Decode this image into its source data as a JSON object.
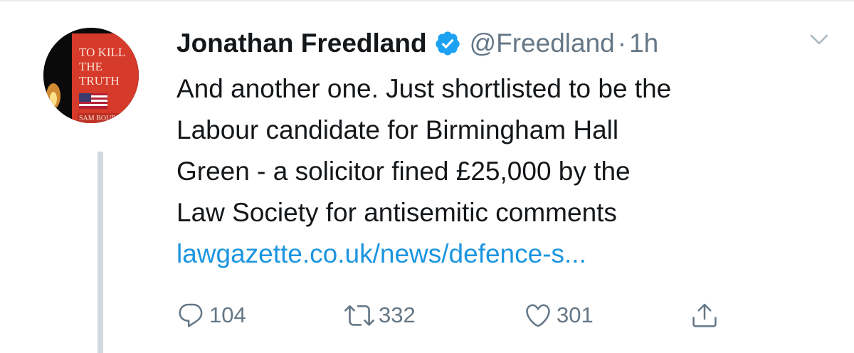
{
  "author": {
    "display_name": "Jonathan Freedland",
    "handle": "@Freedland",
    "separator": "·",
    "time": "1h",
    "avatar_book": {
      "title_line1": "TO KILL",
      "title_line2": "THE",
      "title_line3": "TRUTH",
      "author": "SAM BOURNE"
    }
  },
  "tweet": {
    "lines": [
      "And another one. Just shortlisted to be the",
      "Labour candidate for Birmingham Hall",
      "Green - a solicitor fined £25,000 by the",
      "Law Society for antisemitic comments"
    ],
    "link_text": "lawgazette.co.uk/news/defence-s..."
  },
  "actions": {
    "replies": "104",
    "retweets": "332",
    "likes": "301"
  },
  "colors": {
    "text": "#14171a",
    "secondary": "#657786",
    "link": "#1b95e0",
    "verified": "#1da1f2",
    "book_red": "#d63a2a"
  },
  "icons": {
    "verified": "verified-badge-icon",
    "menu": "chevron-down-icon",
    "reply": "reply-icon",
    "retweet": "retweet-icon",
    "like": "heart-icon",
    "share": "share-icon"
  }
}
